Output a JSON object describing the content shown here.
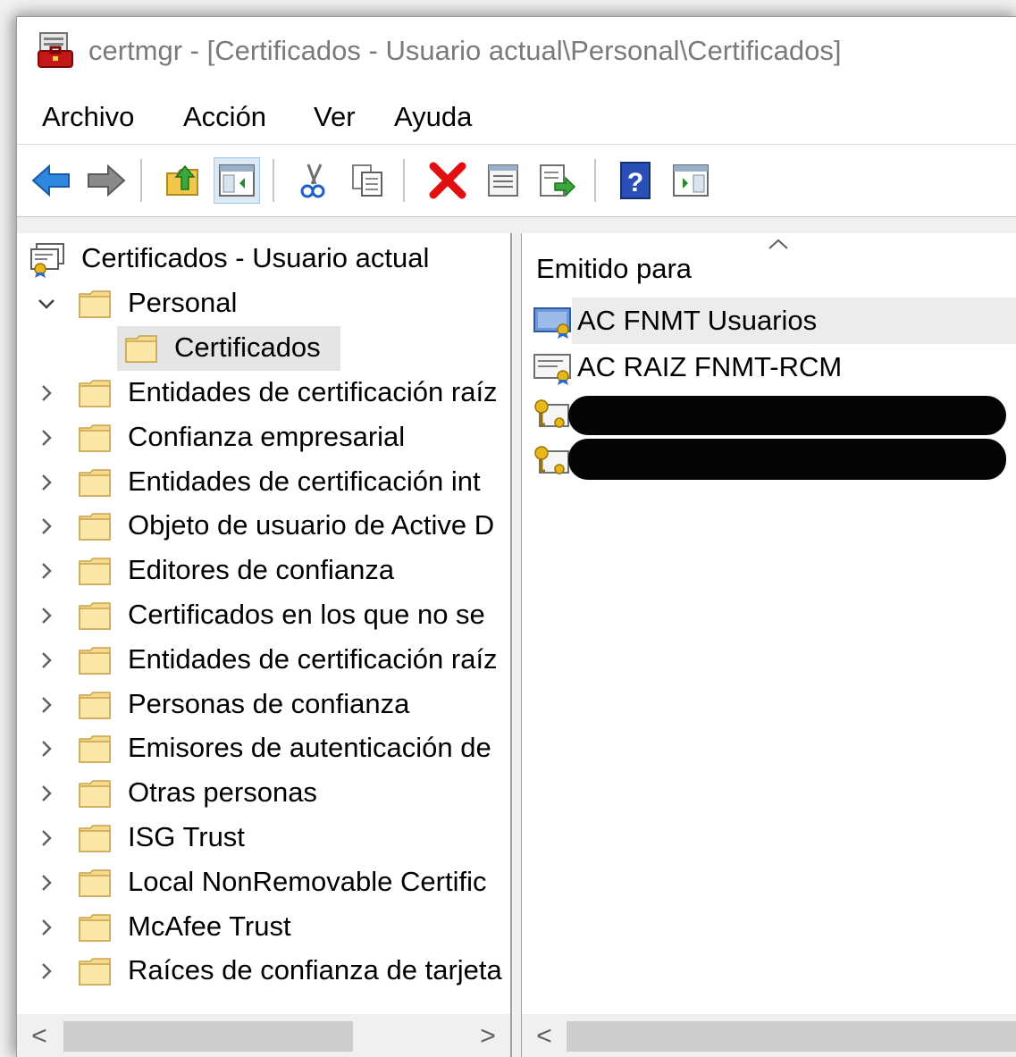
{
  "window": {
    "title": "certmgr - [Certificados - Usuario actual\\Personal\\Certificados]"
  },
  "menu": [
    "Archivo",
    "Acción",
    "Ver",
    "Ayuda"
  ],
  "toolbar": {
    "buttons": [
      "back-arrow-icon",
      "forward-arrow-icon",
      "up-folder-icon",
      "show-hide-console-tree-icon",
      "cut-icon",
      "copy-icon",
      "delete-icon",
      "properties-icon",
      "export-list-icon",
      "help-icon",
      "show-hide-action-pane-icon"
    ]
  },
  "tree": {
    "root": "Certificados - Usuario actual",
    "personal": "Personal",
    "certificados": "Certificados",
    "stores": [
      "Entidades de certificación raíz",
      "Confianza empresarial",
      "Entidades de certificación int",
      "Objeto de usuario de Active D",
      "Editores de confianza",
      "Certificados en los que no se",
      "Entidades de certificación raíz",
      "Personas de confianza",
      "Emisores de autenticación de",
      "Otras personas",
      "ISG Trust",
      "Local NonRemovable Certific",
      "McAfee Trust",
      "Raíces de confianza de tarjeta"
    ]
  },
  "list": {
    "column_header": "Emitido para",
    "rows": [
      "AC FNMT Usuarios",
      "AC RAIZ FNMT-RCM",
      "",
      ""
    ]
  },
  "scroll": {
    "left": "<",
    "right": ">"
  },
  "colors": {
    "selection": "#e5e5e5",
    "accent": "#1e6fd0",
    "delete_red": "#e01010"
  }
}
